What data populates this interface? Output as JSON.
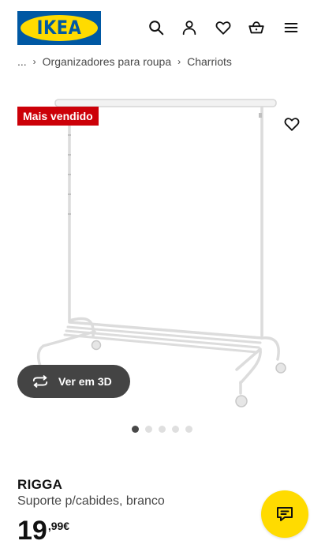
{
  "header": {
    "logo_text": "IKEA",
    "icons": [
      "search-icon",
      "user-icon",
      "heart-icon",
      "basket-icon",
      "menu-icon"
    ]
  },
  "breadcrumb": {
    "ellipsis": "...",
    "items": [
      "Organizadores para roupa",
      "Charriots"
    ]
  },
  "product": {
    "badge": "Mais vendido",
    "view_3d_label": "Ver em 3D",
    "name": "RIGGA",
    "description": "Suporte p/cabides, branco",
    "price_integer": "19",
    "price_decimal": ",99",
    "price_currency": "€",
    "image_count": 5,
    "active_image": 1
  },
  "colors": {
    "brand_blue": "#0058a3",
    "brand_yellow": "#ffdb00",
    "badge_red": "#cc0008",
    "button_dark": "#444444"
  }
}
